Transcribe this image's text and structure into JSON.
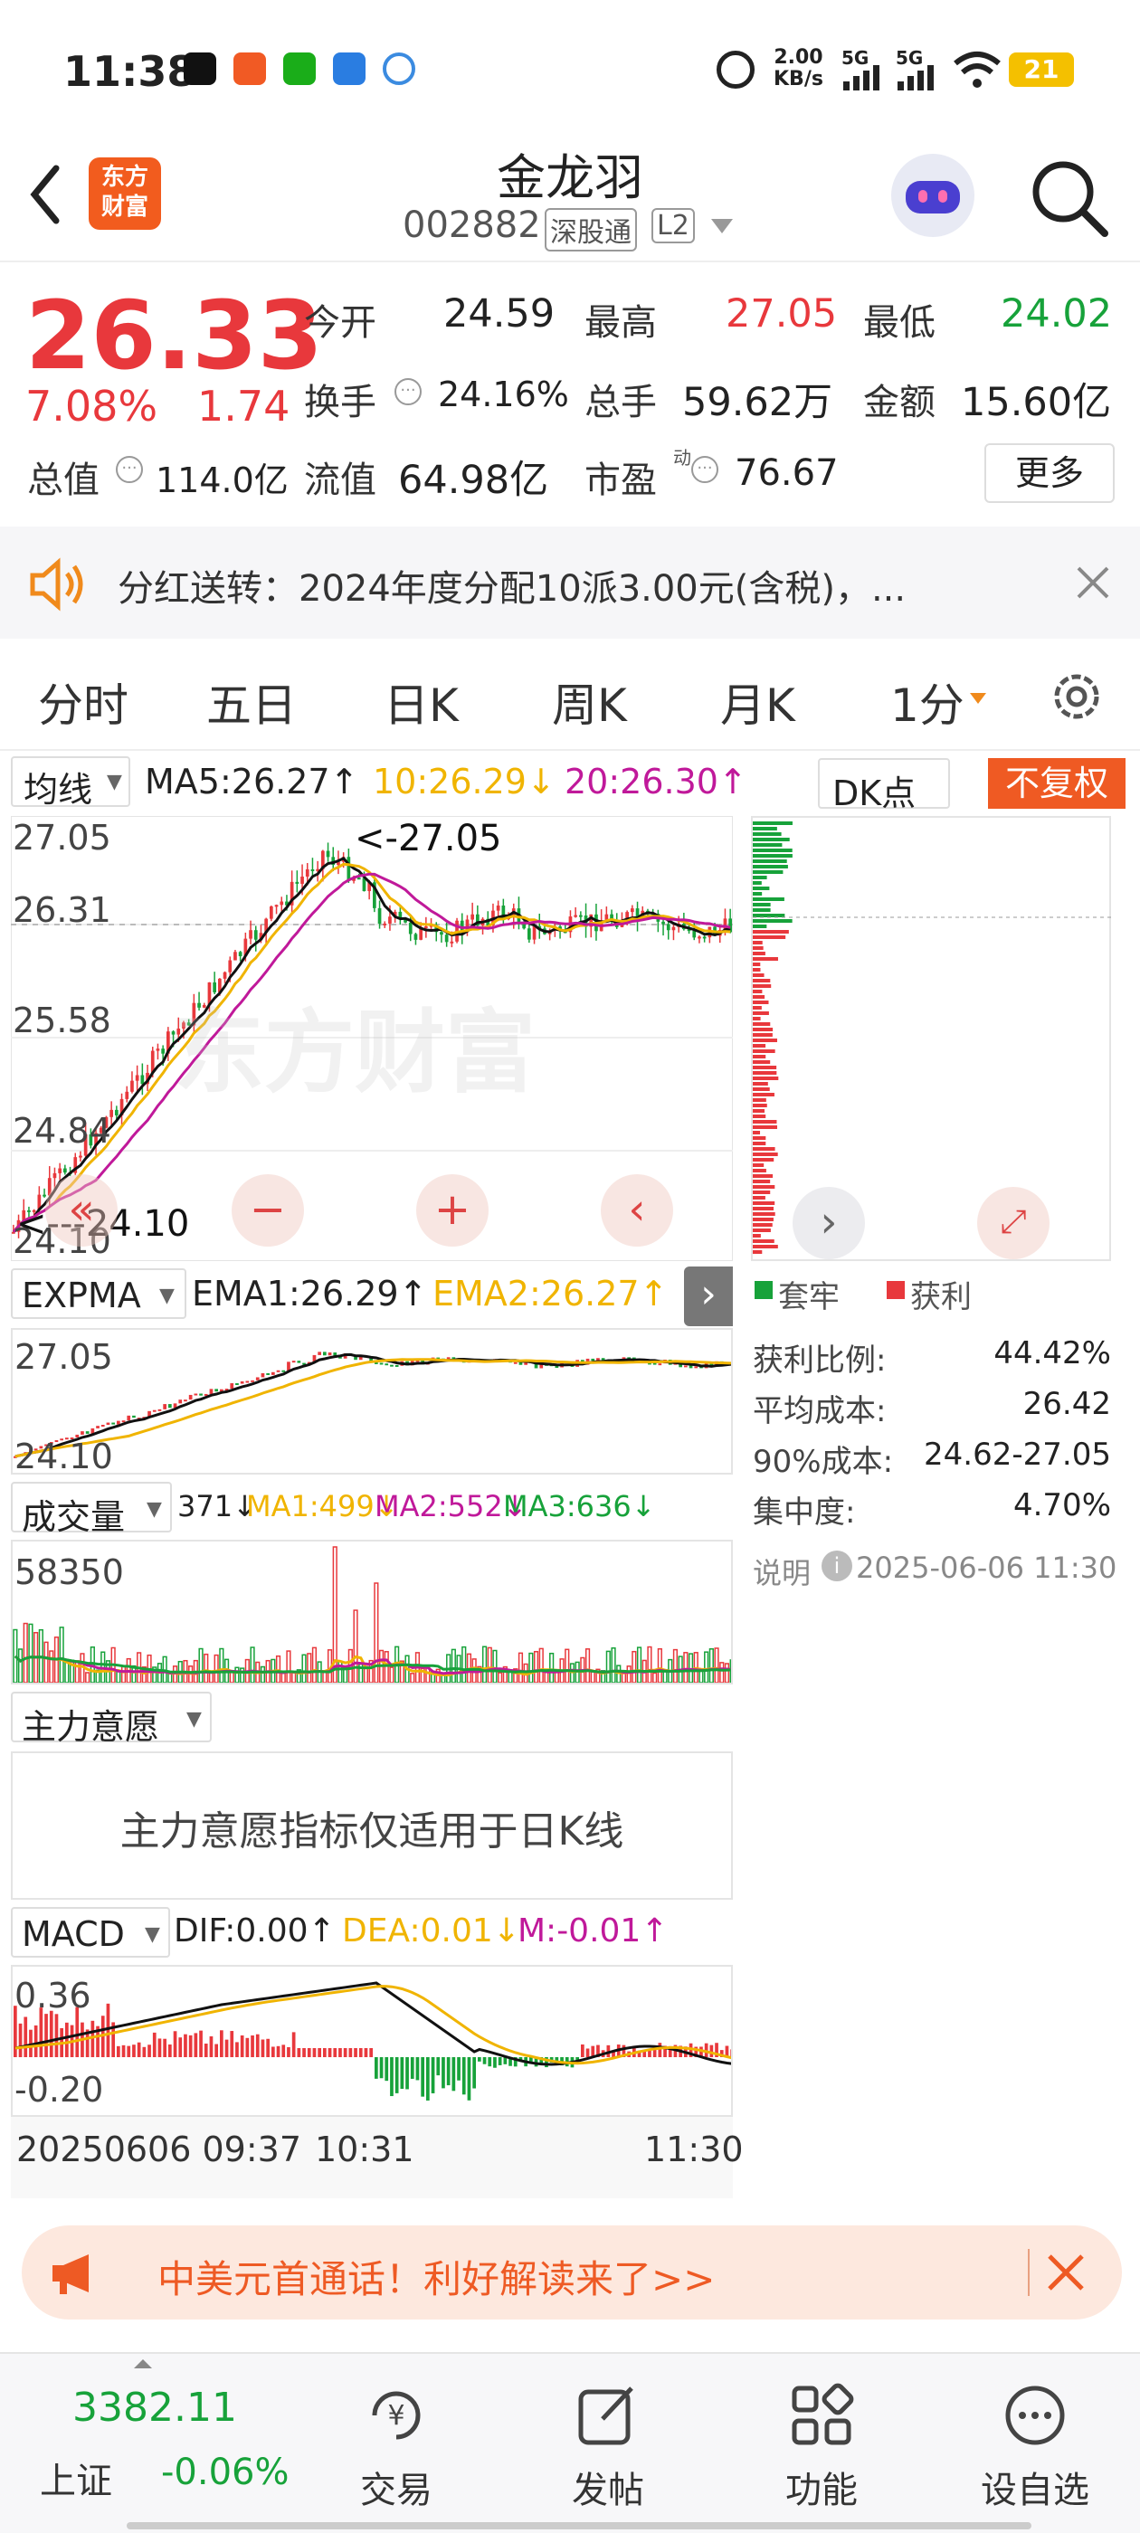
{
  "status": {
    "time": "11:38",
    "net_speed": "2.00",
    "net_unit": "KB/s",
    "battery": "21",
    "sig1": "5G",
    "sig2": "5G"
  },
  "header": {
    "logo_line1": "东方",
    "logo_line2": "财富",
    "name": "金龙羽",
    "code": "002882",
    "tag1": "深股通",
    "tag2": "L2"
  },
  "quote": {
    "price": "26.33",
    "pct": "7.08%",
    "chg": "1.74",
    "open_label": "今开",
    "open": "24.59",
    "high_label": "最高",
    "high": "27.05",
    "low_label": "最低",
    "low": "24.02",
    "turnover_label": "换手",
    "turnover": "24.16%",
    "volume_label": "总手",
    "volume": "59.62万",
    "amount_label": "金额",
    "amount": "15.60亿",
    "mktcap_label": "总值",
    "mktcap": "114.0亿",
    "float_label": "流值",
    "float": "64.98亿",
    "pe_label": "市盈",
    "pe_sup": "动",
    "pe": "76.67",
    "more": "更多"
  },
  "notice": {
    "text": "分红送转：2024年度分配10派3.00元(含税)，..."
  },
  "tabs": [
    "分时",
    "五日",
    "日K",
    "周K",
    "月K",
    "1分"
  ],
  "ma_line": {
    "label": "均线",
    "ma5": "MA5:26.27↑",
    "ma10": "10:26.29↓",
    "ma20": "20:26.30↑",
    "dk": "DK点",
    "fq": "不复权"
  },
  "main_chart": {
    "y1": "27.05",
    "y2": "26.31",
    "y3": "25.58",
    "y4": "24.84",
    "y5": "24.10",
    "hi_tag": "<-27.05",
    "lo_tag": "<---24.10",
    "watermark": "东方财富"
  },
  "expma": {
    "label": "EXPMA",
    "ema1": "EMA1:26.29↑",
    "ema2": "EMA2:26.27↑",
    "y1": "27.05",
    "y2": "24.10"
  },
  "chips": {
    "legend_trap": "套牢",
    "legend_profit": "获利",
    "rows": [
      {
        "k": "获利比例:",
        "v": "44.42%"
      },
      {
        "k": "平均成本:",
        "v": "26.42"
      },
      {
        "k": "90%成本:",
        "v": "24.62-27.05"
      },
      {
        "k": "集中度:",
        "v": "4.70%"
      }
    ],
    "note_label": "说明",
    "note_time": "2025-06-06 11:30"
  },
  "vol": {
    "label": "成交量",
    "v": "371↓",
    "ma1": "MA1:499↓",
    "ma2": "MA2:552↓",
    "ma3": "MA3:636↓",
    "y1": "58350"
  },
  "zlyy": {
    "label": "主力意愿",
    "msg": "主力意愿指标仅适用于日K线"
  },
  "macd": {
    "label": "MACD",
    "dif": "DIF:0.00↑",
    "dea": "DEA:0.01↓",
    "m": "M:-0.01↑",
    "y1": "0.36",
    "y2": "-0.20"
  },
  "time_axis": {
    "t1": "20250606 09:37",
    "t2": "10:31",
    "t3": "11:30"
  },
  "ad": {
    "text": "中美元首通话！利好解读来了>>"
  },
  "nav": {
    "index_value": "3382.11",
    "index_name": "上证",
    "index_pct": "-0.06%",
    "trade": "交易",
    "post": "发帖",
    "func": "功能",
    "watch": "设自选"
  },
  "colors": {
    "up": "#e8383c",
    "down": "#17a23a",
    "accent": "#f08a1c",
    "ma10": "#f0b400",
    "ma20": "#c0199a"
  }
}
